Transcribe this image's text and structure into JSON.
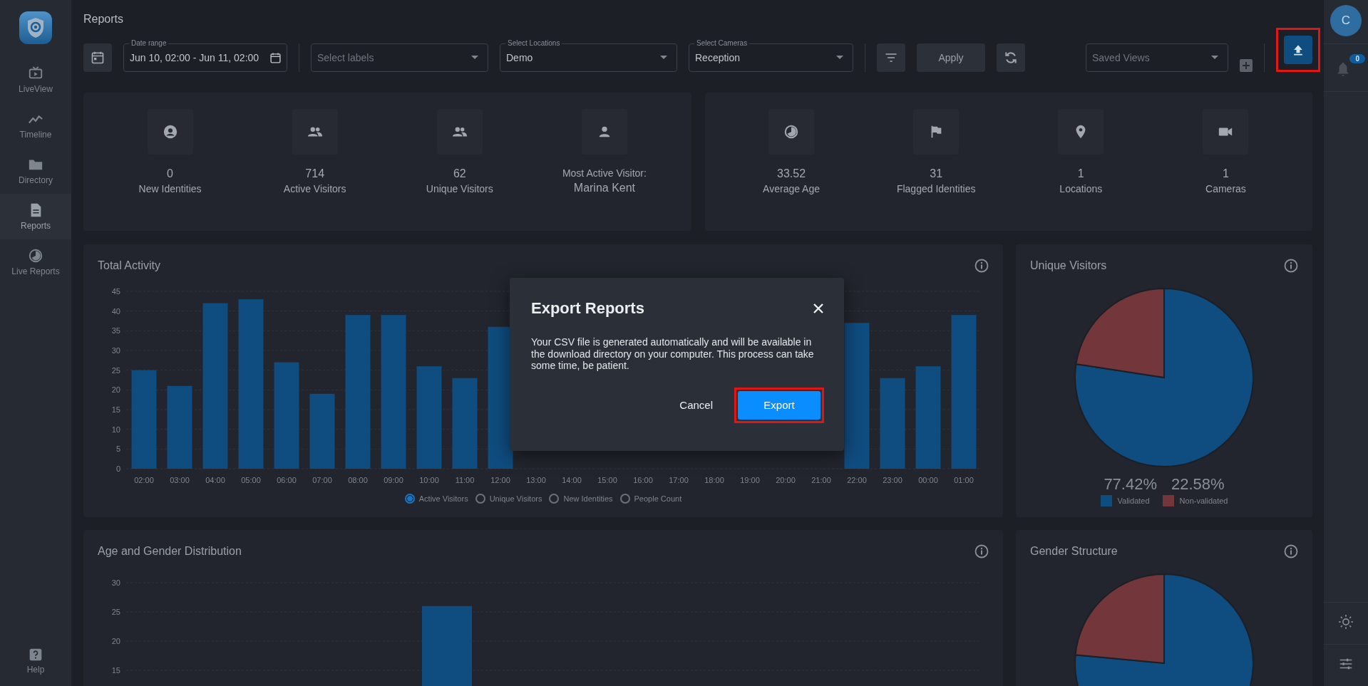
{
  "page_title": "Reports",
  "sidebar": {
    "items": [
      {
        "label": "LiveView",
        "kind": "tv",
        "selected": false
      },
      {
        "label": "Timeline",
        "kind": "trend",
        "selected": false
      },
      {
        "label": "Directory",
        "kind": "folder",
        "selected": false
      },
      {
        "label": "Reports",
        "kind": "document",
        "selected": true
      },
      {
        "label": "Live Reports",
        "kind": "pie",
        "selected": false
      }
    ],
    "help": "Help"
  },
  "toolbar": {
    "date_range": {
      "label": "Date range",
      "value": "Jun 10, 02:00 - Jun 11, 02:00"
    },
    "labels_select": {
      "placeholder": "Select labels"
    },
    "locations_select": {
      "label": "Select Locations",
      "value": "Demo"
    },
    "cameras_select": {
      "label": "Select Cameras",
      "value": "Reception"
    },
    "apply": "Apply",
    "saved_views": {
      "placeholder": "Saved Views"
    }
  },
  "user": {
    "initial": "C"
  },
  "notifications": {
    "count": "0"
  },
  "stats": [
    [
      {
        "kind": "identity",
        "value": "0",
        "label": "New Identities"
      },
      {
        "kind": "group",
        "value": "714",
        "label": "Active Visitors"
      },
      {
        "kind": "group",
        "value": "62",
        "label": "Unique Visitors"
      },
      {
        "kind": "visitor",
        "label": "Most Active Visitor:",
        "value": "Marina Kent"
      }
    ],
    [
      {
        "kind": "age",
        "value": "33.52",
        "label": "Average Age"
      },
      {
        "kind": "flag",
        "value": "31",
        "label": "Flagged Identities"
      },
      {
        "kind": "location",
        "value": "1",
        "label": "Locations"
      },
      {
        "kind": "camera",
        "value": "1",
        "label": "Cameras"
      }
    ]
  ],
  "total_activity": {
    "title": "Total Activity",
    "chart_data": {
      "type": "bar",
      "categories": [
        "02:00",
        "03:00",
        "04:00",
        "05:00",
        "06:00",
        "07:00",
        "08:00",
        "09:00",
        "10:00",
        "11:00",
        "12:00",
        "13:00",
        "14:00",
        "15:00",
        "16:00",
        "17:00",
        "18:00",
        "19:00",
        "20:00",
        "21:00",
        "22:00",
        "23:00",
        "00:00",
        "01:00"
      ],
      "series": [
        {
          "color": "#0f4c7f",
          "values": [
            25,
            21,
            42,
            43,
            27,
            19,
            39,
            39,
            26,
            23,
            36,
            null,
            null,
            null,
            null,
            null,
            null,
            null,
            null,
            null,
            37,
            23,
            26,
            39
          ]
        }
      ],
      "ylim": [
        0,
        45
      ],
      "grid": true,
      "yticks": [
        0,
        5,
        10,
        15,
        20,
        25,
        30,
        35,
        40,
        45
      ]
    },
    "legend": [
      {
        "label": "Active Visitors",
        "selected": true
      },
      {
        "label": "Unique Visitors",
        "selected": false
      },
      {
        "label": "New Identities",
        "selected": false
      },
      {
        "label": "People Count",
        "selected": false
      }
    ]
  },
  "unique_visitors": {
    "title": "Unique Visitors",
    "chart_data": {
      "type": "pie",
      "categories": [
        "Validated",
        "Non-validated"
      ],
      "series": [
        {
          "values": [
            77.42,
            22.58
          ]
        }
      ]
    },
    "percentages": [
      "77.42%",
      "22.58%"
    ],
    "legend": [
      {
        "color": "#0f4c7f"
      },
      {
        "color": "#73363b"
      }
    ]
  },
  "age_gender": {
    "title": "Age and Gender Distribution",
    "chart_data": {
      "type": "bar",
      "series": [
        {
          "color": "#0f4c7f",
          "values": [
            null,
            null,
            null,
            null,
            26,
            null,
            null,
            null,
            null,
            null,
            null,
            null
          ]
        }
      ],
      "ylim": [
        0,
        30
      ],
      "grid": true,
      "yticks": [
        15,
        20,
        25,
        30
      ]
    }
  },
  "gender_structure": {
    "title": "Gender Structure"
  },
  "dialog": {
    "title": "Export Reports",
    "message": "Your CSV file is generated automatically and will be available in the download directory on your computer. This process can take some time, be patient.",
    "buttons": [
      {
        "label": "Cancel",
        "kind": "text"
      },
      {
        "label": "Export",
        "kind": "primary"
      }
    ]
  }
}
